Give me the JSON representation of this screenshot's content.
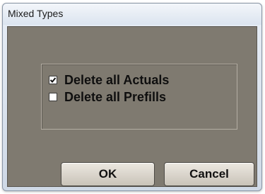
{
  "window": {
    "title": "Mixed Types"
  },
  "options": [
    {
      "label": "Delete all Actuals",
      "checked": true
    },
    {
      "label": "Delete all Prefills",
      "checked": false
    }
  ],
  "buttons": {
    "ok_label": "OK",
    "cancel_label": "Cancel"
  }
}
